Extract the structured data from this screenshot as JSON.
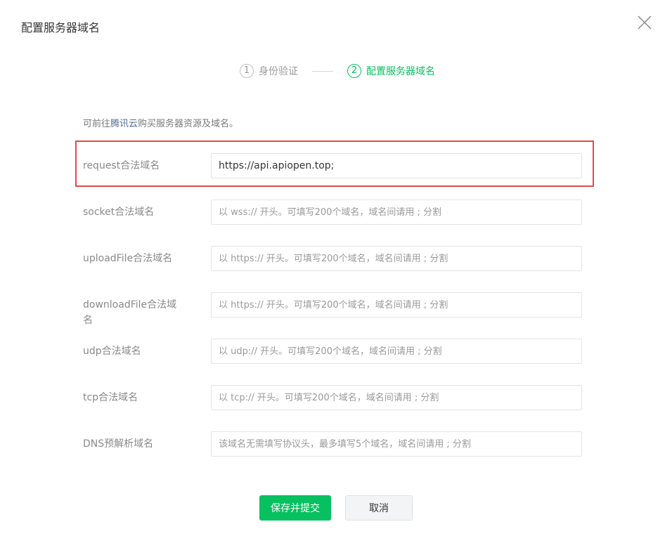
{
  "dialog": {
    "title": "配置服务器域名",
    "close_icon": "close-icon"
  },
  "steps": [
    {
      "num": "1",
      "label": "身份验证",
      "active": false
    },
    {
      "num": "2",
      "label": "配置服务器域名",
      "active": true
    }
  ],
  "tip": {
    "prefix": "可前往",
    "link": "腾讯云",
    "suffix": "购买服务器资源及域名。"
  },
  "fields": [
    {
      "label": "request合法域名",
      "value": "https://api.apiopen.top;",
      "placeholder": ""
    },
    {
      "label": "socket合法域名",
      "value": "",
      "placeholder": "以 wss:// 开头。可填写200个域名，域名间请用 ; 分割"
    },
    {
      "label": "uploadFile合法域名",
      "value": "",
      "placeholder": "以 https:// 开头。可填写200个域名，域名间请用 ; 分割"
    },
    {
      "label": "downloadFile合法域名",
      "value": "",
      "placeholder": "以 https:// 开头。可填写200个域名，域名间请用 ; 分割"
    },
    {
      "label": "udp合法域名",
      "value": "",
      "placeholder": "以 udp:// 开头。可填写200个域名，域名间请用 ; 分割"
    },
    {
      "label": "tcp合法域名",
      "value": "",
      "placeholder": "以 tcp:// 开头。可填写200个域名，域名间请用 ; 分割"
    },
    {
      "label": "DNS预解析域名",
      "value": "",
      "placeholder": "该域名无需填写协议头，最多填写5个域名，域名间请用 ; 分割"
    }
  ],
  "buttons": {
    "submit": "保存并提交",
    "cancel": "取消"
  },
  "colors": {
    "accent": "#07c160",
    "link": "#576b95",
    "highlight": "#e34a4a"
  }
}
